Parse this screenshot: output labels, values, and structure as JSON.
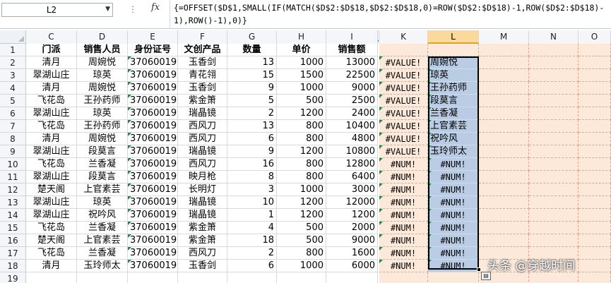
{
  "formula_bar": {
    "name_box": "L2",
    "fx": "fx",
    "formula": "{=OFFSET($D$1,SMALL(IF(MATCH($D$2:$D$18,$D$2:$D$18,0)=ROW($D$2:$D$18)-1,ROW($D$2:$D$18)-1),ROW()-1),0)}"
  },
  "columns": [
    "C",
    "D",
    "E",
    "F",
    "G",
    "H",
    "I",
    "J",
    "K",
    "L",
    "M",
    "N",
    "O"
  ],
  "row_numbers": [
    "1",
    "2",
    "3",
    "4",
    "5",
    "6",
    "7",
    "8",
    "9",
    "10",
    "11",
    "12",
    "13",
    "14",
    "15",
    "16",
    "17",
    "18",
    "19"
  ],
  "headers": [
    "门派",
    "销售人员",
    "身份证号",
    "文创产品",
    "数量",
    "单价",
    "销售额"
  ],
  "rows": [
    [
      "清月",
      "周婉悦",
      "37060019",
      "玉香剑",
      "13",
      "1000",
      "13000",
      "#VALUE!",
      "周婉悦"
    ],
    [
      "翠湖山庄",
      "琼英",
      "37060019",
      "青花翎",
      "15",
      "1500",
      "22500",
      "#VALUE!",
      "琼英"
    ],
    [
      "清月",
      "周婉悦",
      "37060019",
      "玉香剑",
      "9",
      "1000",
      "9000",
      "#VALUE!",
      "王孙药师"
    ],
    [
      "飞花岛",
      "王孙药师",
      "37060019",
      "紫金箫",
      "5",
      "500",
      "2500",
      "#VALUE!",
      "段莫言"
    ],
    [
      "翠湖山庄",
      "琼英",
      "37060019",
      "瑞晶镜",
      "2",
      "1200",
      "2400",
      "#VALUE!",
      "兰香凝"
    ],
    [
      "飞花岛",
      "王孙药师",
      "37060019",
      "西风刀",
      "13",
      "800",
      "10400",
      "#VALUE!",
      "上官素芸"
    ],
    [
      "清月",
      "周婉悦",
      "37060019",
      "西风刀",
      "6",
      "800",
      "4800",
      "#VALUE!",
      "祝吟风"
    ],
    [
      "翠湖山庄",
      "段莫言",
      "37060019",
      "瑞晶镜",
      "9",
      "1200",
      "10800",
      "#VALUE!",
      "玉玲师太"
    ],
    [
      "飞花岛",
      "兰香凝",
      "37060019",
      "西风刀",
      "16",
      "800",
      "12800",
      "#NUM!",
      "#NUM!"
    ],
    [
      "翠湖山庄",
      "段莫言",
      "37060019",
      "映月枪",
      "8",
      "800",
      "6400",
      "#NUM!",
      "#NUM!"
    ],
    [
      "楚天阁",
      "上官素芸",
      "37060019",
      "长明灯",
      "3",
      "1000",
      "3000",
      "#NUM!",
      "#NUM!"
    ],
    [
      "翠湖山庄",
      "琼英",
      "37060019",
      "瑞晶镜",
      "10",
      "1200",
      "12000",
      "#NUM!",
      "#NUM!"
    ],
    [
      "翠湖山庄",
      "祝吟风",
      "37060019",
      "瑞晶镜",
      "1",
      "1200",
      "1200",
      "#NUM!",
      "#NUM!"
    ],
    [
      "飞花岛",
      "兰香凝",
      "37060019",
      "紫金箫",
      "4",
      "500",
      "2000",
      "#NUM!",
      "#NUM!"
    ],
    [
      "楚天阁",
      "上官素芸",
      "37060019",
      "紫金箫",
      "18",
      "500",
      "9000",
      "#NUM!",
      "#NUM!"
    ],
    [
      "飞花岛",
      "兰香凝",
      "37060019",
      "西风刀",
      "2",
      "800",
      "1600",
      "#NUM!",
      "#NUM!"
    ],
    [
      "清月",
      "玉玲师太",
      "37060019",
      "玉香剑",
      "6",
      "1000",
      "6000",
      "#NUM!",
      "#NUM!"
    ]
  ],
  "watermark": "头条 @穿越时间",
  "colors": {
    "selection_fill": "#b9cce4",
    "peach_fill": "#fde9d9",
    "active_header": "#f9d99d"
  }
}
